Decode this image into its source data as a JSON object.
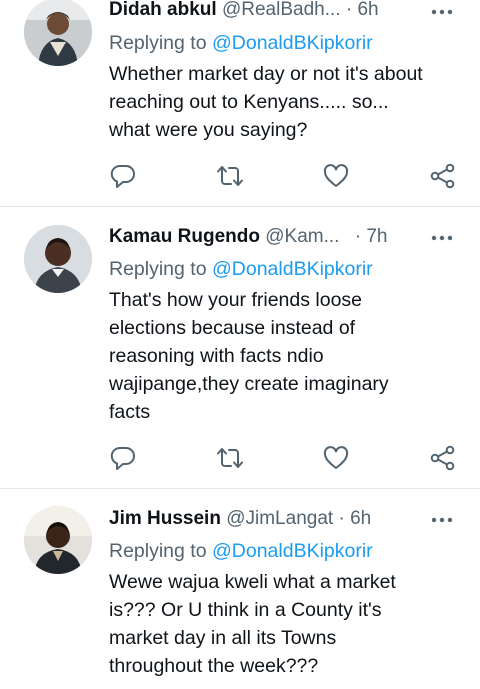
{
  "tweets": [
    {
      "name": "Didah abkul",
      "handle": "@RealBadh...",
      "dot": "·",
      "time": "6h",
      "replying_prefix": "Replying to",
      "replying_mention": "@DonaldBKipkorir",
      "text": "Whether market day or not it's about\nreaching out to Kenyans..... so...\nwhat were you saying?"
    },
    {
      "name": "Kamau Rugendo",
      "handle": "@Kam...",
      "dot": "·",
      "time": "7h",
      "replying_prefix": "Replying to",
      "replying_mention": "@DonaldBKipkorir",
      "text": "That's how your friends loose\nelections because instead of\nreasoning with facts ndio\nwajipange,they create imaginary\nfacts"
    },
    {
      "name": "Jim Hussein",
      "handle": "@JimLangat",
      "dot": "·",
      "time": "6h",
      "replying_prefix": "Replying to",
      "replying_mention": "@DonaldBKipkorir",
      "text": "Wewe wajua kweli what a market\nis??? Or U think in a County it's\nmarket day in all its Towns\nthroughout the week???"
    }
  ],
  "icons": {
    "more": "more-horizontal-icon",
    "reply": "reply-icon",
    "retweet": "retweet-icon",
    "like": "heart-icon",
    "share": "share-icon"
  },
  "colors": {
    "accent": "#1d9bf0",
    "secondary_text": "#536471",
    "icon": "#536471",
    "divider": "#e6e9eb"
  }
}
